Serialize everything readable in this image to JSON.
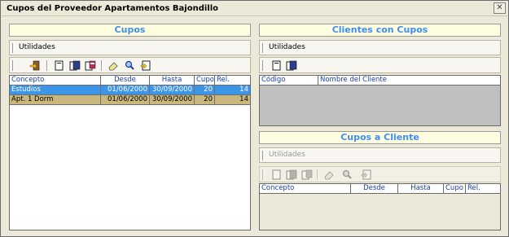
{
  "window": {
    "title": "Cupos del Proveedor Apartamentos Bajondillo"
  },
  "cupos": {
    "header": "Cupos",
    "menu_label": "Utilidades",
    "columns": [
      "Concepto",
      "Desde",
      "Hasta",
      "Cupo",
      "Rel."
    ],
    "rows": [
      {
        "concepto": "Estudios",
        "desde": "01/06/2000",
        "hasta": "30/09/2000",
        "cupo": "20",
        "rel": "14"
      },
      {
        "concepto": "Apt. 1 Dorm",
        "desde": "01/06/2000",
        "hasta": "30/09/2000",
        "cupo": "20",
        "rel": "14"
      }
    ]
  },
  "clientes": {
    "header": "Clientes con Cupos",
    "menu_label": "Utilidades",
    "columns": [
      "Código",
      "Nombre del Cliente"
    ]
  },
  "cupos_cliente": {
    "header": "Cupos a Cliente",
    "menu_label": "Utilidades",
    "columns": [
      "Concepto",
      "Desde",
      "Hasta",
      "Cupo",
      "Rel."
    ]
  },
  "colors": {
    "header_text": "#3f8ef0",
    "header_bg": "#fffde0",
    "selected_row": "#3d95e8",
    "alt_row": "#c9b77e"
  },
  "icons": {
    "cupos_toolbar": [
      "exit-icon",
      "new-record-icon",
      "open-record-icon",
      "print-record-icon",
      "erase-icon",
      "search-icon",
      "report-icon"
    ],
    "clientes_toolbar": [
      "new-record-icon",
      "open-record-icon"
    ],
    "cupos_cliente_toolbar": [
      "new-record-icon",
      "open-record-icon",
      "print-record-icon",
      "erase-icon",
      "search-icon",
      "report-icon"
    ]
  }
}
